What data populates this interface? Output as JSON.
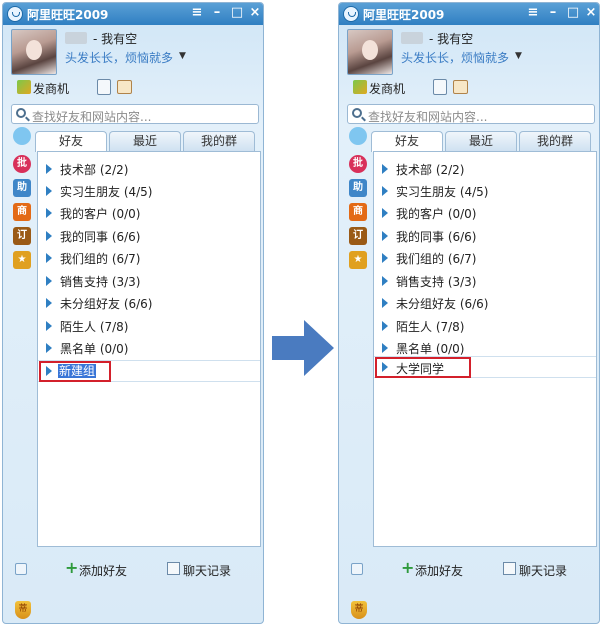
{
  "app_title": "阿里旺旺2009",
  "title_buttons": [
    "≡",
    "–",
    "□",
    "×"
  ],
  "profile": {
    "status": "- 我有空",
    "signature": "头发长长，烦恼就多",
    "signature_arrow": "▼"
  },
  "toolbar": {
    "fashang_label": "发商机"
  },
  "search": {
    "placeholder": "查找好友和网站内容..."
  },
  "sidebar": {
    "icons": [
      {
        "name": "wangwang-face-icon",
        "glyph": "",
        "color": "#7fc6f0"
      },
      {
        "name": "pi-icon",
        "glyph": "批",
        "color": "#d8305a"
      },
      {
        "name": "zhu-icon",
        "glyph": "助",
        "color": "#3f86c8"
      },
      {
        "name": "shang-icon",
        "glyph": "商",
        "color": "#e36a16"
      },
      {
        "name": "ding-icon",
        "glyph": "订",
        "color": "#9a5a16"
      },
      {
        "name": "star-icon",
        "glyph": "★",
        "color": "#e0a020"
      }
    ]
  },
  "tabs": [
    "好友",
    "最近",
    "我的群"
  ],
  "groups": [
    "技术部 (2/2)",
    "实习生朋友 (4/5)",
    "我的客户 (0/0)",
    "我的同事 (6/6)",
    "我们组的 (6/7)",
    "销售支持 (3/3)",
    "未分组好友 (6/6)",
    "陌生人 (7/8)",
    "黑名单 (0/0)"
  ],
  "new_group_before": "新建组",
  "new_group_after": "大学同学",
  "bottom": {
    "add_friend": "添加好友",
    "chat_history": "聊天记录"
  },
  "shield_glyph": "蒂",
  "accent_color": "#3a7cc4",
  "arrow_color": "#4a7bc0"
}
